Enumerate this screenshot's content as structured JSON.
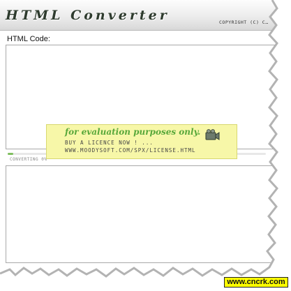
{
  "app": {
    "title": "HTML Converter",
    "copyright": "COPYRIGHT (C) C…"
  },
  "main": {
    "html_label": "HTML Code:",
    "progress_text": "CONVERTING 0%",
    "progress": 0
  },
  "banner": {
    "line1": "for evaluation purposes only.",
    "line2": "BUY A LICENCE NOW ! ...",
    "line3": "WWW.MOODYSOFT.COM/SPX/LICENSE.HTML",
    "icon": "camera-icon"
  },
  "watermark": {
    "text": "www.cncrk.com"
  },
  "colors": {
    "banner_bg": "#f7f7a8",
    "banner_text": "#58a83a",
    "progress_fill": "#7fbf5f",
    "watermark_bg": "#ffff00"
  }
}
